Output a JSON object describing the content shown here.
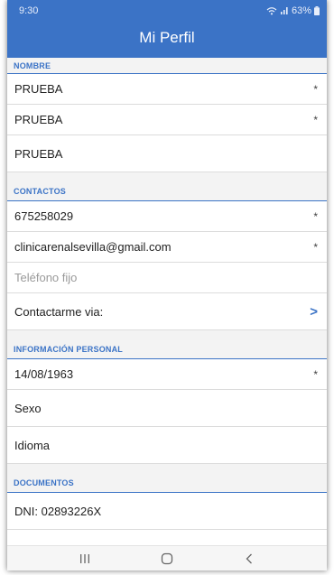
{
  "status_bar": {
    "time": "9:30",
    "battery": "63%"
  },
  "header": {
    "title": "Mi Perfil"
  },
  "sections": {
    "nombre": {
      "label": "NOMBRE",
      "rows": [
        {
          "value": "PRUEBA",
          "required": "*"
        },
        {
          "value": "PRUEBA",
          "required": "*"
        },
        {
          "value": "PRUEBA"
        }
      ]
    },
    "contactos": {
      "label": "CONTACTOS",
      "phone": "675258029",
      "email": "clinicarenalsevilla@gmail.com",
      "landline_placeholder": "Teléfono fijo",
      "contact_via": "Contactarme via:",
      "required": "*",
      "chevron": ">"
    },
    "informacion_personal": {
      "label": "INFORMACIÓN PERSONAL",
      "birthdate": "14/08/1963",
      "required": "*",
      "sex": "Sexo",
      "language": "Idioma"
    },
    "documentos": {
      "label": "DOCUMENTOS",
      "dni": "DNI: 02893226X"
    }
  },
  "navbar": {
    "icons": [
      "recents-icon",
      "home-icon",
      "back-icon"
    ]
  },
  "colors": {
    "primary": "#3b73c6",
    "section_bg": "#f3f3f3",
    "divider": "#dcdcdc"
  }
}
